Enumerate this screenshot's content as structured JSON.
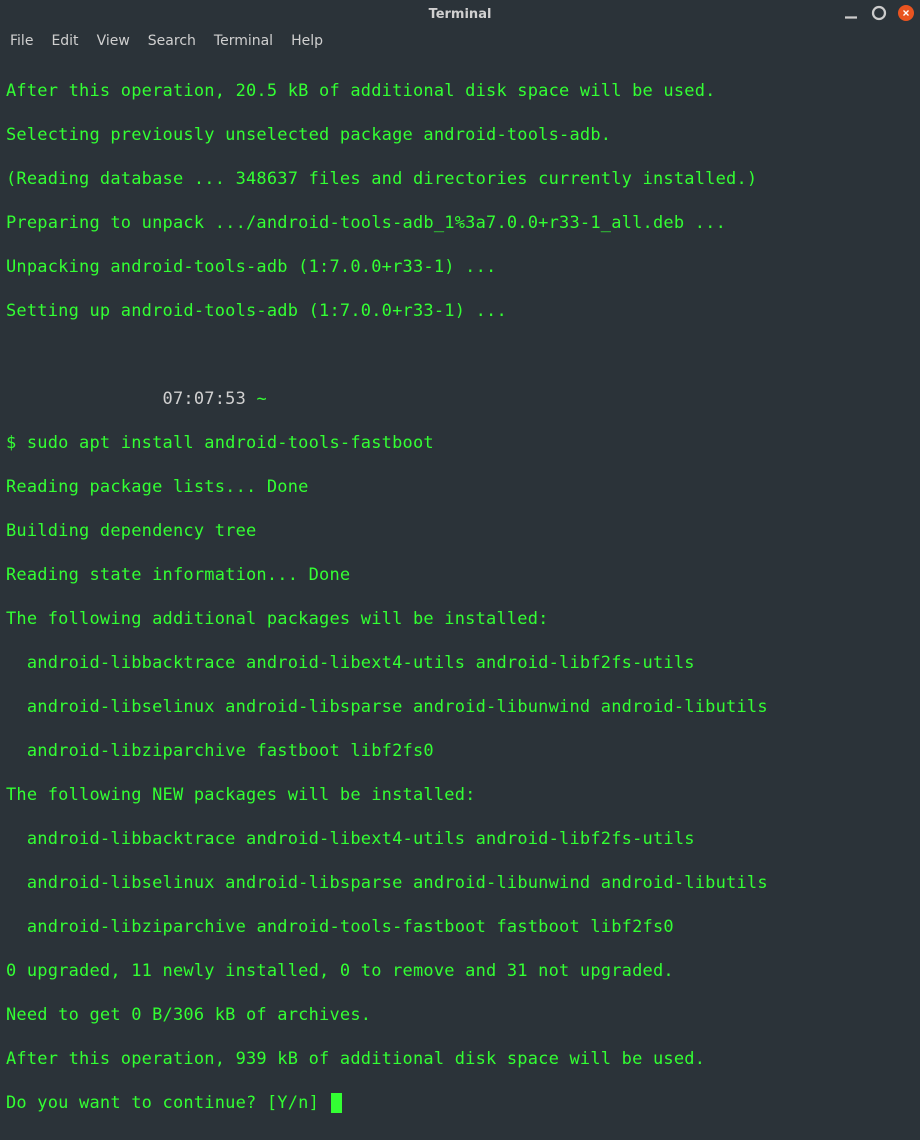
{
  "window": {
    "title": "Terminal"
  },
  "menu": {
    "file": "File",
    "edit": "Edit",
    "view": "View",
    "search": "Search",
    "terminal": "Terminal",
    "help": "Help"
  },
  "lines": {
    "l0": "After this operation, 20.5 kB of additional disk space will be used.",
    "l1": "Selecting previously unselected package android-tools-adb.",
    "l2": "(Reading database ... 348637 files and directories currently installed.)",
    "l3": "Preparing to unpack .../android-tools-adb_1%3a7.0.0+r33-1_all.deb ...",
    "l4": "Unpacking android-tools-adb (1:7.0.0+r33-1) ...",
    "l5": "Setting up android-tools-adb (1:7.0.0+r33-1) ...",
    "l6_time": "               07:07:53 ",
    "l6_tilde": "~",
    "l7": "$ sudo apt install android-tools-fastboot",
    "l8": "Reading package lists... Done",
    "l9": "Building dependency tree",
    "l10": "Reading state information... Done",
    "l11": "The following additional packages will be installed:",
    "l12": "  android-libbacktrace android-libext4-utils android-libf2fs-utils",
    "l13": "  android-libselinux android-libsparse android-libunwind android-libutils",
    "l14": "  android-libziparchive fastboot libf2fs0",
    "l15": "The following NEW packages will be installed:",
    "l16": "  android-libbacktrace android-libext4-utils android-libf2fs-utils",
    "l17": "  android-libselinux android-libsparse android-libunwind android-libutils",
    "l18": "  android-libziparchive android-tools-fastboot fastboot libf2fs0",
    "l19": "0 upgraded, 11 newly installed, 0 to remove and 31 not upgraded.",
    "l20": "Need to get 0 B/306 kB of archives.",
    "l21": "After this operation, 939 kB of additional disk space will be used.",
    "l22": "Do you want to continue? [Y/n] "
  }
}
